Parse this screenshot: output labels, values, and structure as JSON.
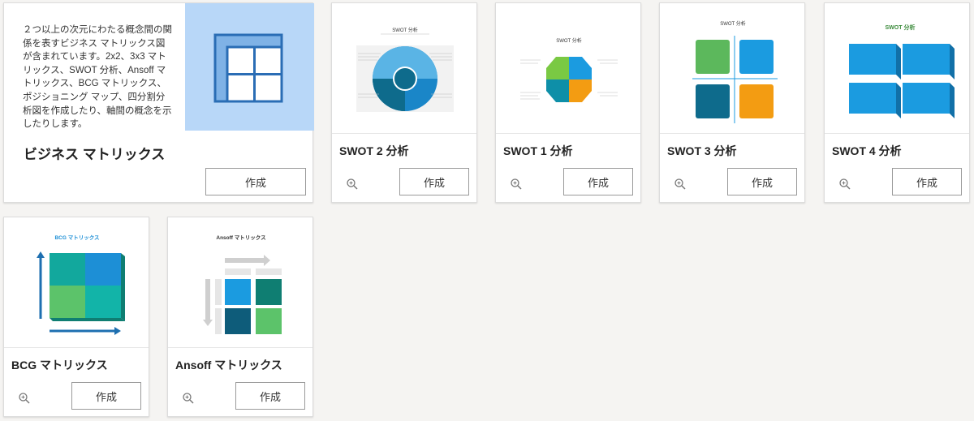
{
  "featured": {
    "description": "２つ以上の次元にわたる概念間の関係を表すビジネス マトリックス図が含まれています。2x2、3x3 マトリックス、SWOT 分析、Ansoff マトリックス、BCG マトリックス、ポジショニング マップ、四分割分析図を作成したり、軸間の概念を示したりします。",
    "title": "ビジネス マトリックス",
    "create_label": "作成"
  },
  "templates": [
    {
      "title": "SWOT 2 分析",
      "create_label": "作成",
      "thumb_title": "SWOT 分析"
    },
    {
      "title": "SWOT 1 分析",
      "create_label": "作成",
      "thumb_title": "SWOT 分析"
    },
    {
      "title": "SWOT 3 分析",
      "create_label": "作成",
      "thumb_title": "SWOT 分析"
    },
    {
      "title": "SWOT 4 分析",
      "create_label": "作成",
      "thumb_title": "SWOT 分析"
    },
    {
      "title": "BCG マトリックス",
      "create_label": "作成",
      "thumb_title": "BCG マトリックス"
    },
    {
      "title": "Ansoff マトリックス",
      "create_label": "作成",
      "thumb_title": "Ansoff マトリックス"
    }
  ],
  "colors": {
    "hero_bg": "#b8d7f8",
    "hero_icon": "#2a6db5",
    "swot_green": "#5cb85c",
    "swot_blue": "#1b9be0",
    "swot_teal": "#0e6b8c",
    "swot_orange": "#f39c12",
    "bcg_teal": "#12a89d",
    "bcg_blue": "#1d8fd6",
    "ansoff_teal": "#0f7e72"
  }
}
